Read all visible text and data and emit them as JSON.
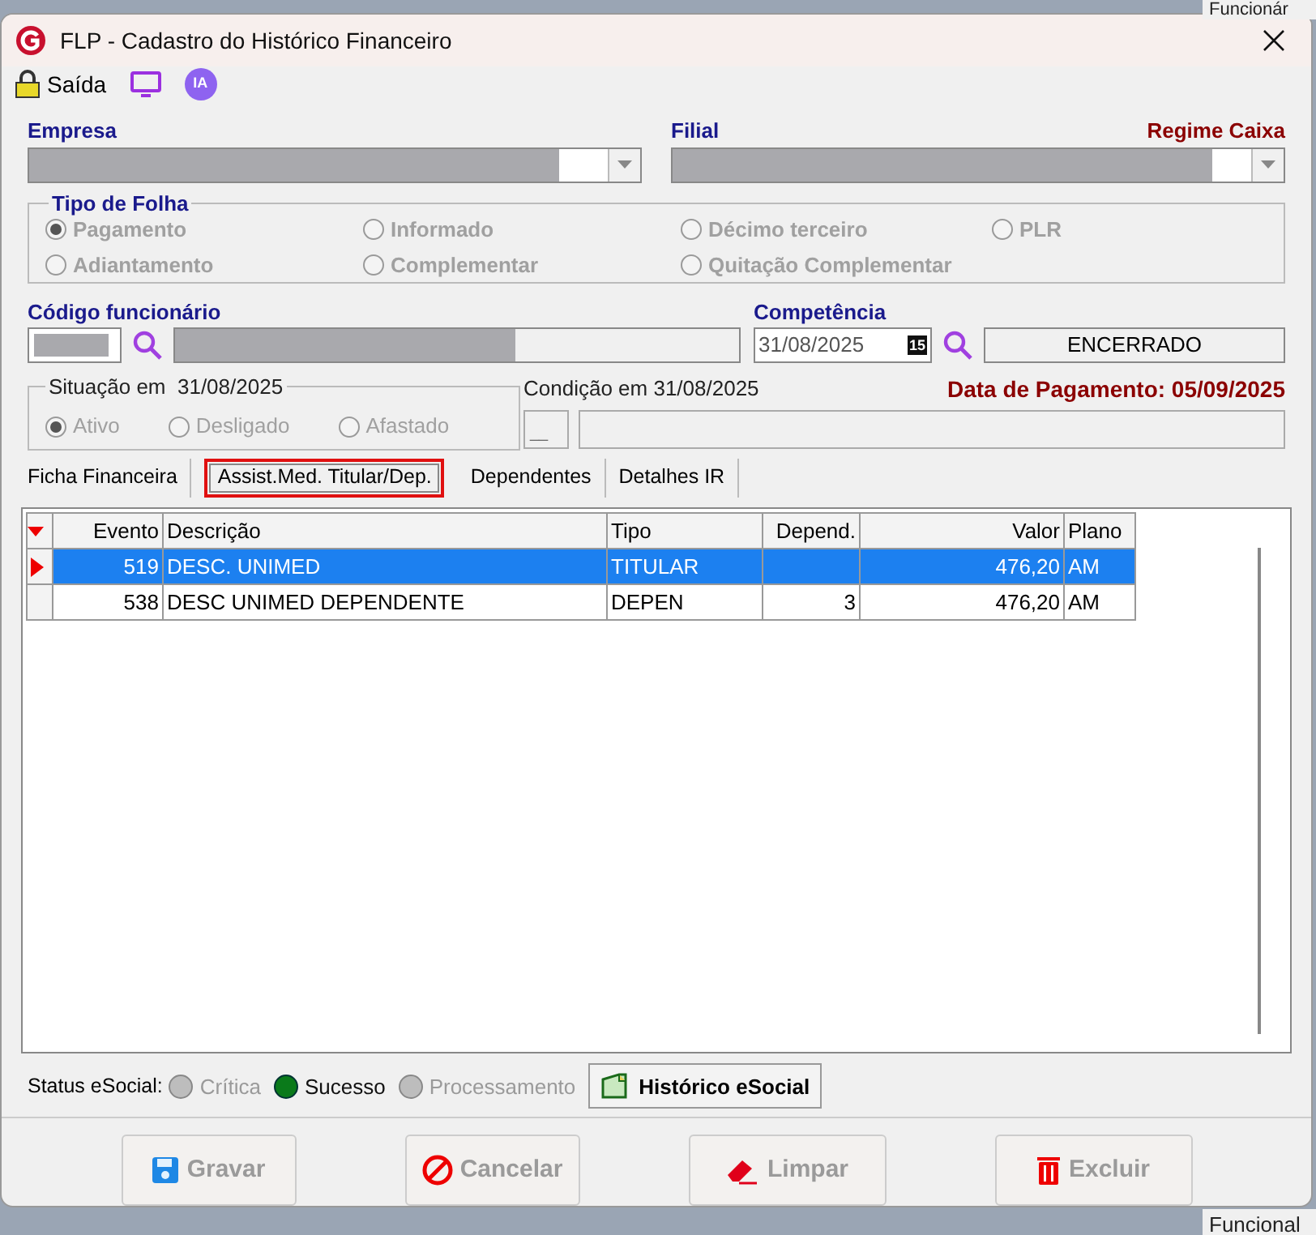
{
  "background_texts": [
    "Funcionár",
    "Funcional"
  ],
  "window": {
    "title": "FLP - Cadastro do Histórico Financeiro"
  },
  "toolbar": {
    "exit_label": "Saída",
    "ia_label": "IA"
  },
  "empresa": {
    "label": "Empresa"
  },
  "filial": {
    "label": "Filial",
    "regime": "Regime Caixa"
  },
  "tipo_folha": {
    "title": "Tipo de Folha",
    "options": [
      {
        "label": "Pagamento",
        "selected": true
      },
      {
        "label": "Informado",
        "selected": false
      },
      {
        "label": "Décimo terceiro",
        "selected": false
      },
      {
        "label": "PLR",
        "selected": false
      },
      {
        "label": "Adiantamento",
        "selected": false
      },
      {
        "label": "Complementar",
        "selected": false
      },
      {
        "label": "Quitação Complementar",
        "selected": false
      }
    ]
  },
  "codigo": {
    "label": "Código funcionário"
  },
  "competencia": {
    "label": "Competência",
    "value": "31/08/2025",
    "calendar": "15",
    "status": "ENCERRADO"
  },
  "situacao": {
    "title": "Situação em  31/08/2025",
    "options": [
      {
        "label": "Ativo",
        "selected": true
      },
      {
        "label": "Desligado",
        "selected": false
      },
      {
        "label": "Afastado",
        "selected": false
      }
    ]
  },
  "condicao": {
    "label": "Condição em 31/08/2025",
    "value": "__"
  },
  "data_pagamento": "Data de Pagamento: 05/09/2025",
  "tabs": [
    {
      "label": "Ficha Financeira",
      "selected": false
    },
    {
      "label": "Assist.Med. Titular/Dep.",
      "selected": true
    },
    {
      "label": "Dependentes",
      "selected": false
    },
    {
      "label": "Detalhes IR",
      "selected": false
    }
  ],
  "table": {
    "columns": [
      "Evento",
      "Descrição",
      "Tipo",
      "Depend.",
      "Valor",
      "Plano"
    ],
    "rows": [
      {
        "cells": [
          "519",
          "DESC. UNIMED",
          "TITULAR",
          "",
          "476,20",
          "AM"
        ],
        "selected": true
      },
      {
        "cells": [
          "538",
          "DESC UNIMED DEPENDENTE",
          "DEPEN",
          "3",
          "476,20",
          "AM"
        ],
        "selected": false
      }
    ]
  },
  "status_esocial": {
    "label": "Status eSocial:",
    "items": [
      {
        "label": "Crítica",
        "selected": false
      },
      {
        "label": "Sucesso",
        "selected": true
      },
      {
        "label": "Processamento",
        "selected": false
      }
    ],
    "history_button": "Histórico eSocial"
  },
  "buttons": [
    {
      "label": "Gravar",
      "kind": "save",
      "disabled": true
    },
    {
      "label": "Cancelar",
      "kind": "cancel",
      "disabled": true
    },
    {
      "label": "Limpar",
      "kind": "clear",
      "disabled": true
    },
    {
      "label": "Excluir",
      "kind": "delete",
      "disabled": true
    }
  ]
}
